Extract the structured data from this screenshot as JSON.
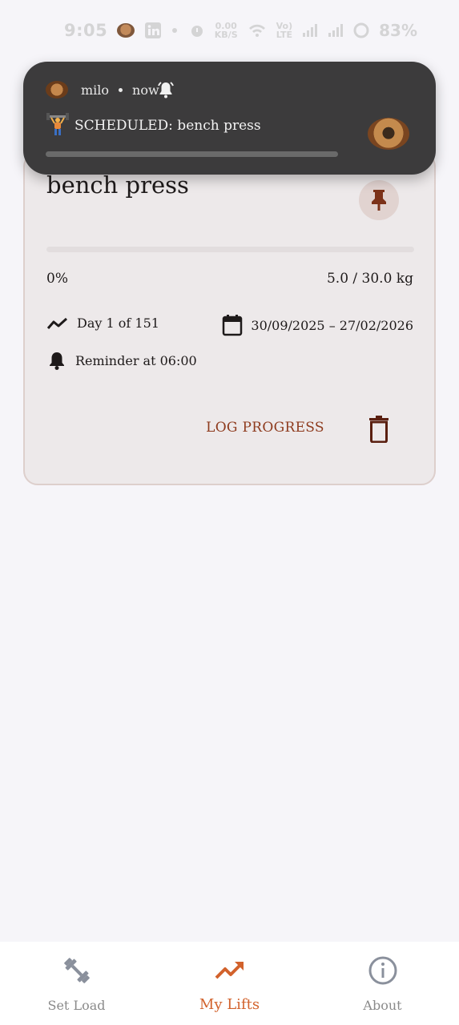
{
  "status_bar": {
    "time": "9:05",
    "speed": "0.00",
    "speed_unit": "KB/S",
    "network": "Vo)",
    "network_sub": "LTE",
    "battery": "83%"
  },
  "notification": {
    "app_name": "milo",
    "time": "now",
    "title": "SCHEDULED: bench press",
    "progress": 0
  },
  "card": {
    "title": "bench press",
    "progress_percent": 0,
    "percent_label": "0%",
    "weight_label": "5.0 / 30.0 kg",
    "day_label": "Day 1 of 151",
    "date_range": "30/09/2025 – 27/02/2026",
    "reminder_label": "Reminder at 06:00",
    "log_button": "LOG PROGRESS"
  },
  "bottom_nav": {
    "items": [
      {
        "label": "Set Load",
        "icon": "dumbbell-icon",
        "active": false
      },
      {
        "label": "My Lifts",
        "icon": "trending-up-icon",
        "active": true
      },
      {
        "label": "About",
        "icon": "info-icon",
        "active": false
      }
    ]
  },
  "colors": {
    "accent": "#d2622c",
    "brand": "#8e3b1e",
    "card_bg": "#ede9ea",
    "notification_bg": "#3c3b3c"
  }
}
